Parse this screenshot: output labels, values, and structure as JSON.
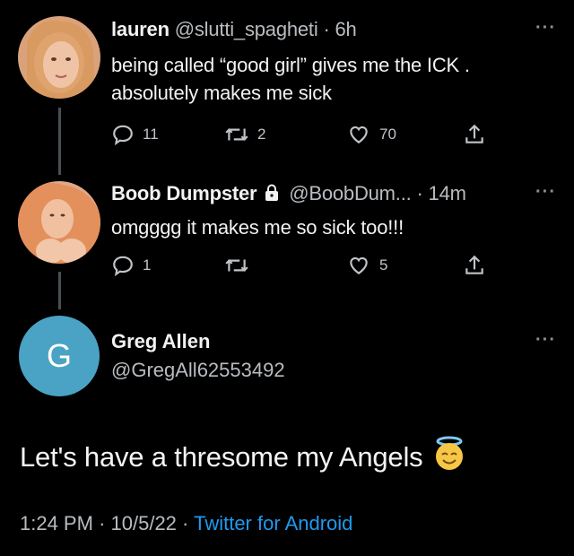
{
  "tweets": [
    {
      "name": "lauren",
      "handle": "@slutti_spagheti",
      "separator": "·",
      "time": "6h",
      "text_lines": [
        "being called “good girl” gives me the ICK .",
        "absolutely makes me sick"
      ],
      "replies": "11",
      "retweets": "2",
      "likes": "70",
      "more": "···"
    },
    {
      "name": "Boob Dumpster",
      "handle": "@BoobDum...",
      "separator": "·",
      "time": "14m",
      "text_lines": [
        "omgggg it makes me so sick too!!!"
      ],
      "replies": "1",
      "retweets": "",
      "likes": "5",
      "more": "···"
    }
  ],
  "main_tweet": {
    "avatar_letter": "G",
    "name": "Greg Allen",
    "handle": "@GregAll62553492",
    "more": "···",
    "text": "Let's have a thresome my Angels",
    "emoji": "smiling-face-with-halo",
    "time": "1:24 PM",
    "date": "10/5/22",
    "separator": "·",
    "source": "Twitter for Android"
  },
  "colors": {
    "background": "#000000",
    "link": "#1d9bf0",
    "avatar_g": "#4aa3c4"
  },
  "icons": [
    "reply-icon",
    "retweet-icon",
    "like-icon",
    "share-icon",
    "lock-icon",
    "more-icon"
  ]
}
